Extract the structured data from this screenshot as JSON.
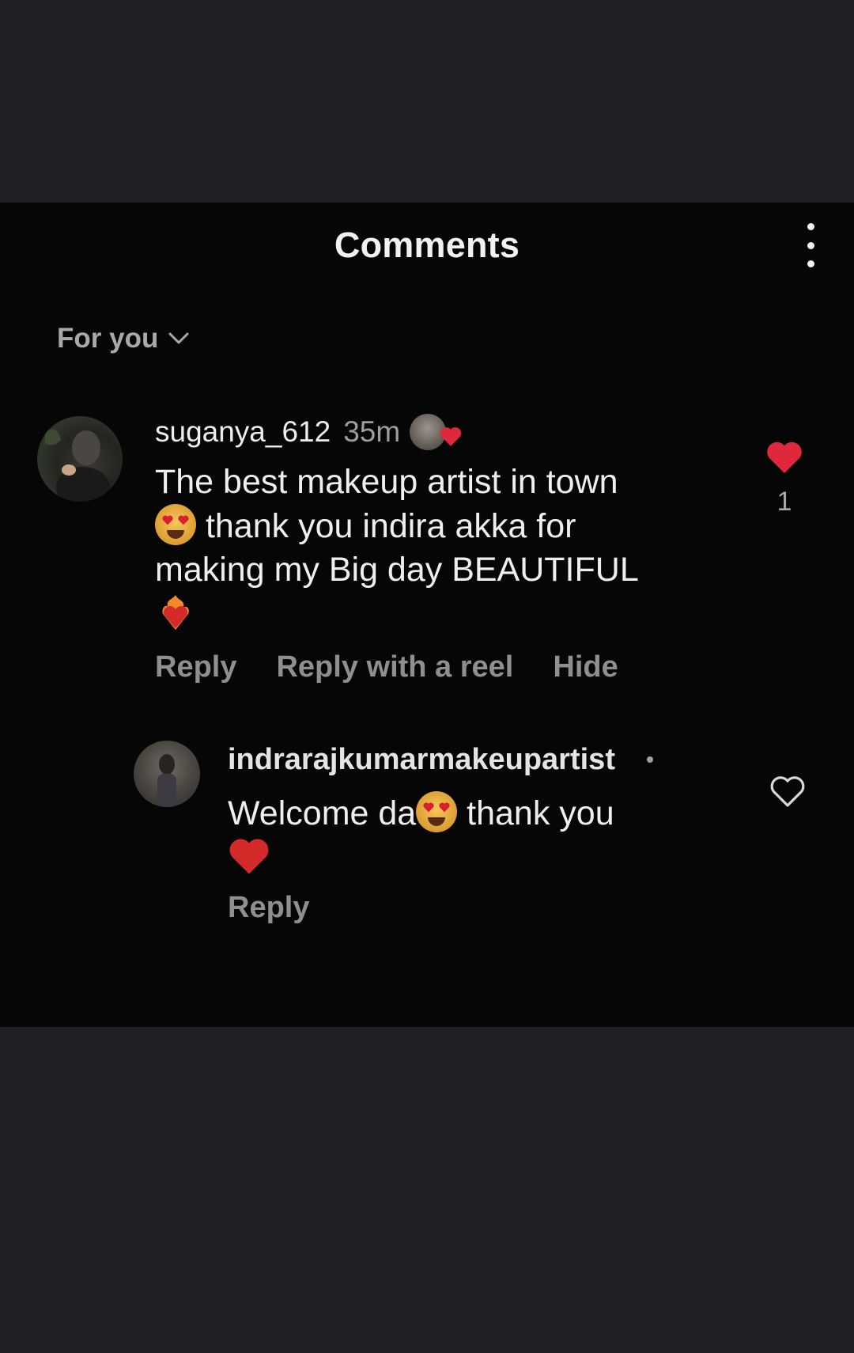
{
  "header": {
    "title": "Comments",
    "more_icon": "more-vertical-icon"
  },
  "filter": {
    "label": "For you",
    "icon": "chevron-down-icon"
  },
  "comment": {
    "username": "suganya_612",
    "time": "35m",
    "liked_by_author": true,
    "text_line_1": "The best makeup artist in town",
    "text_line_2": " thank you indira akka for",
    "text_line_3": "making my Big day BEAUTIFUL",
    "emojis": [
      "smiling-face-with-heart-eyes",
      "heart-on-fire"
    ],
    "like_count": "1",
    "liked": true,
    "actions": {
      "reply": "Reply",
      "reply_with_reel": "Reply with a reel",
      "hide": "Hide"
    }
  },
  "reply": {
    "username": "indrarajkumarmakeupartist",
    "text_part_1": "Welcome da",
    "text_part_2": " thank you",
    "emojis": [
      "smiling-face-with-heart-eyes",
      "red-heart"
    ],
    "liked": false,
    "actions": {
      "reply": "Reply"
    }
  },
  "colors": {
    "background": "#1f2024",
    "panel": "#060606",
    "like_red": "#e0283d",
    "secondary_text": "#8f8f8f"
  }
}
